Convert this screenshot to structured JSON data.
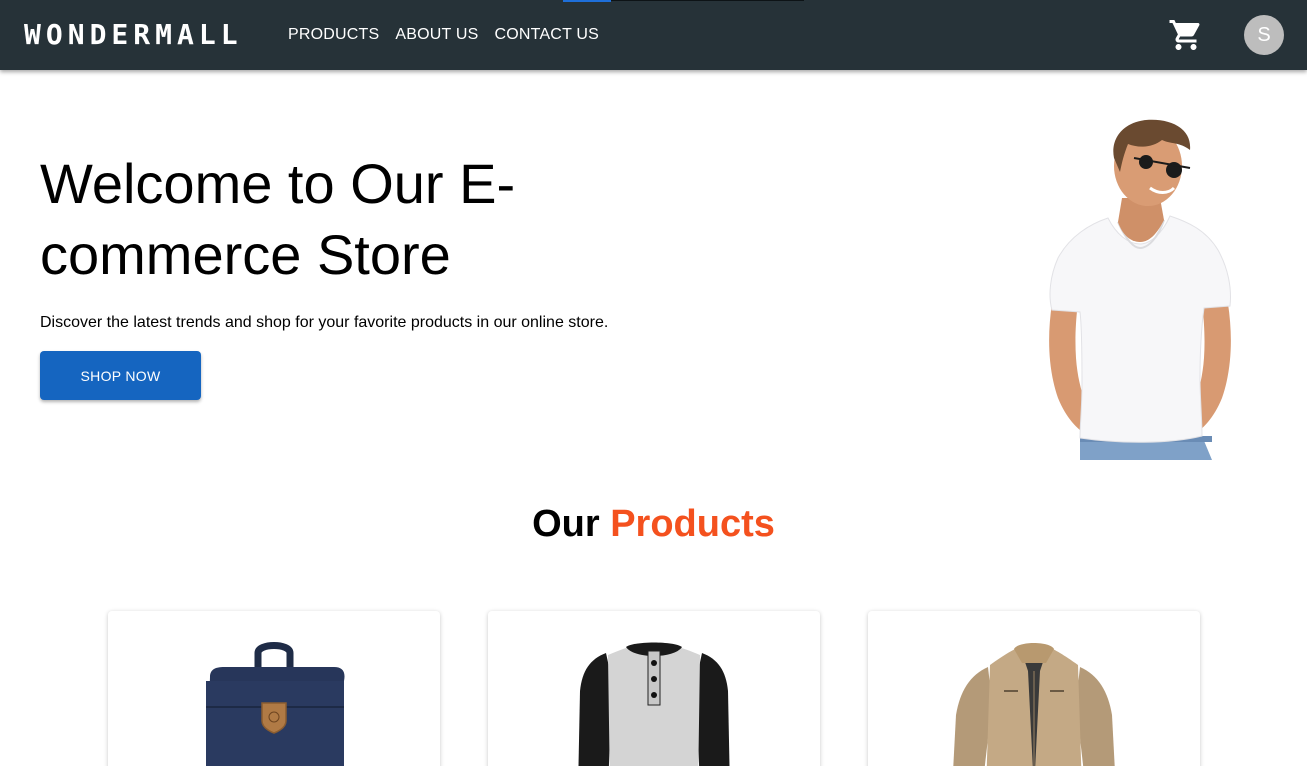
{
  "header": {
    "brand": "WONDERMALL",
    "nav": [
      {
        "label": "PRODUCTS"
      },
      {
        "label": "ABOUT US"
      },
      {
        "label": "CONTACT US"
      }
    ],
    "cart_icon": "shopping-cart-icon",
    "avatar_initial": "S"
  },
  "hero": {
    "title": "Welcome to Our E-commerce Store",
    "subtitle": "Discover the latest trends and shop for your favorite products in our online store.",
    "cta_label": "SHOP NOW"
  },
  "products_section": {
    "heading_part1": "Our",
    "heading_part2": "Products"
  },
  "products": [
    {
      "image": "navy-backpack"
    },
    {
      "image": "black-grey-henley-shirt"
    },
    {
      "image": "khaki-jacket"
    }
  ],
  "colors": {
    "appbar": "#263238",
    "primary_button": "#1565c0",
    "accent": "#f4511e",
    "avatar": "#bdbdbd"
  }
}
